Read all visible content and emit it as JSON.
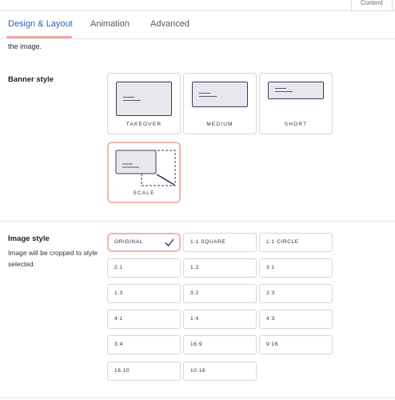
{
  "header": {
    "content_tab_label": "Content"
  },
  "tabs": [
    {
      "label": "Design & Layout",
      "active": true
    },
    {
      "label": "Animation",
      "active": false
    },
    {
      "label": "Advanced",
      "active": false
    }
  ],
  "intro_text_fragment": "the image.",
  "banner_style": {
    "label": "Banner style",
    "options": [
      {
        "label": "TAKEOVER",
        "selected": false
      },
      {
        "label": "MEDIUM",
        "selected": false
      },
      {
        "label": "SHORT",
        "selected": false
      },
      {
        "label": "SCALE",
        "selected": true
      }
    ]
  },
  "image_style": {
    "label": "Image style",
    "help": "Image will be cropped to style selected.",
    "options": [
      {
        "label": "ORIGINAL",
        "selected": true
      },
      {
        "label": "1:1 SQUARE",
        "selected": false
      },
      {
        "label": "1:1 CIRCLE",
        "selected": false
      },
      {
        "label": "2:1",
        "selected": false
      },
      {
        "label": "1:2",
        "selected": false
      },
      {
        "label": "3:1",
        "selected": false
      },
      {
        "label": "1:3",
        "selected": false
      },
      {
        "label": "3:2",
        "selected": false
      },
      {
        "label": "2:3",
        "selected": false
      },
      {
        "label": "4:1",
        "selected": false
      },
      {
        "label": "1:4",
        "selected": false
      },
      {
        "label": "4:3",
        "selected": false
      },
      {
        "label": "3:4",
        "selected": false
      },
      {
        "label": "16:9",
        "selected": false
      },
      {
        "label": "9:16",
        "selected": false
      },
      {
        "label": "16:10",
        "selected": false
      },
      {
        "label": "10:16",
        "selected": false
      }
    ]
  },
  "colors": {
    "accent_blue": "#2f5fb3",
    "selection_border": "#f2b4ab",
    "thumb_fill": "#e9e7ee"
  },
  "icons": {
    "selected_check": "check-icon"
  }
}
